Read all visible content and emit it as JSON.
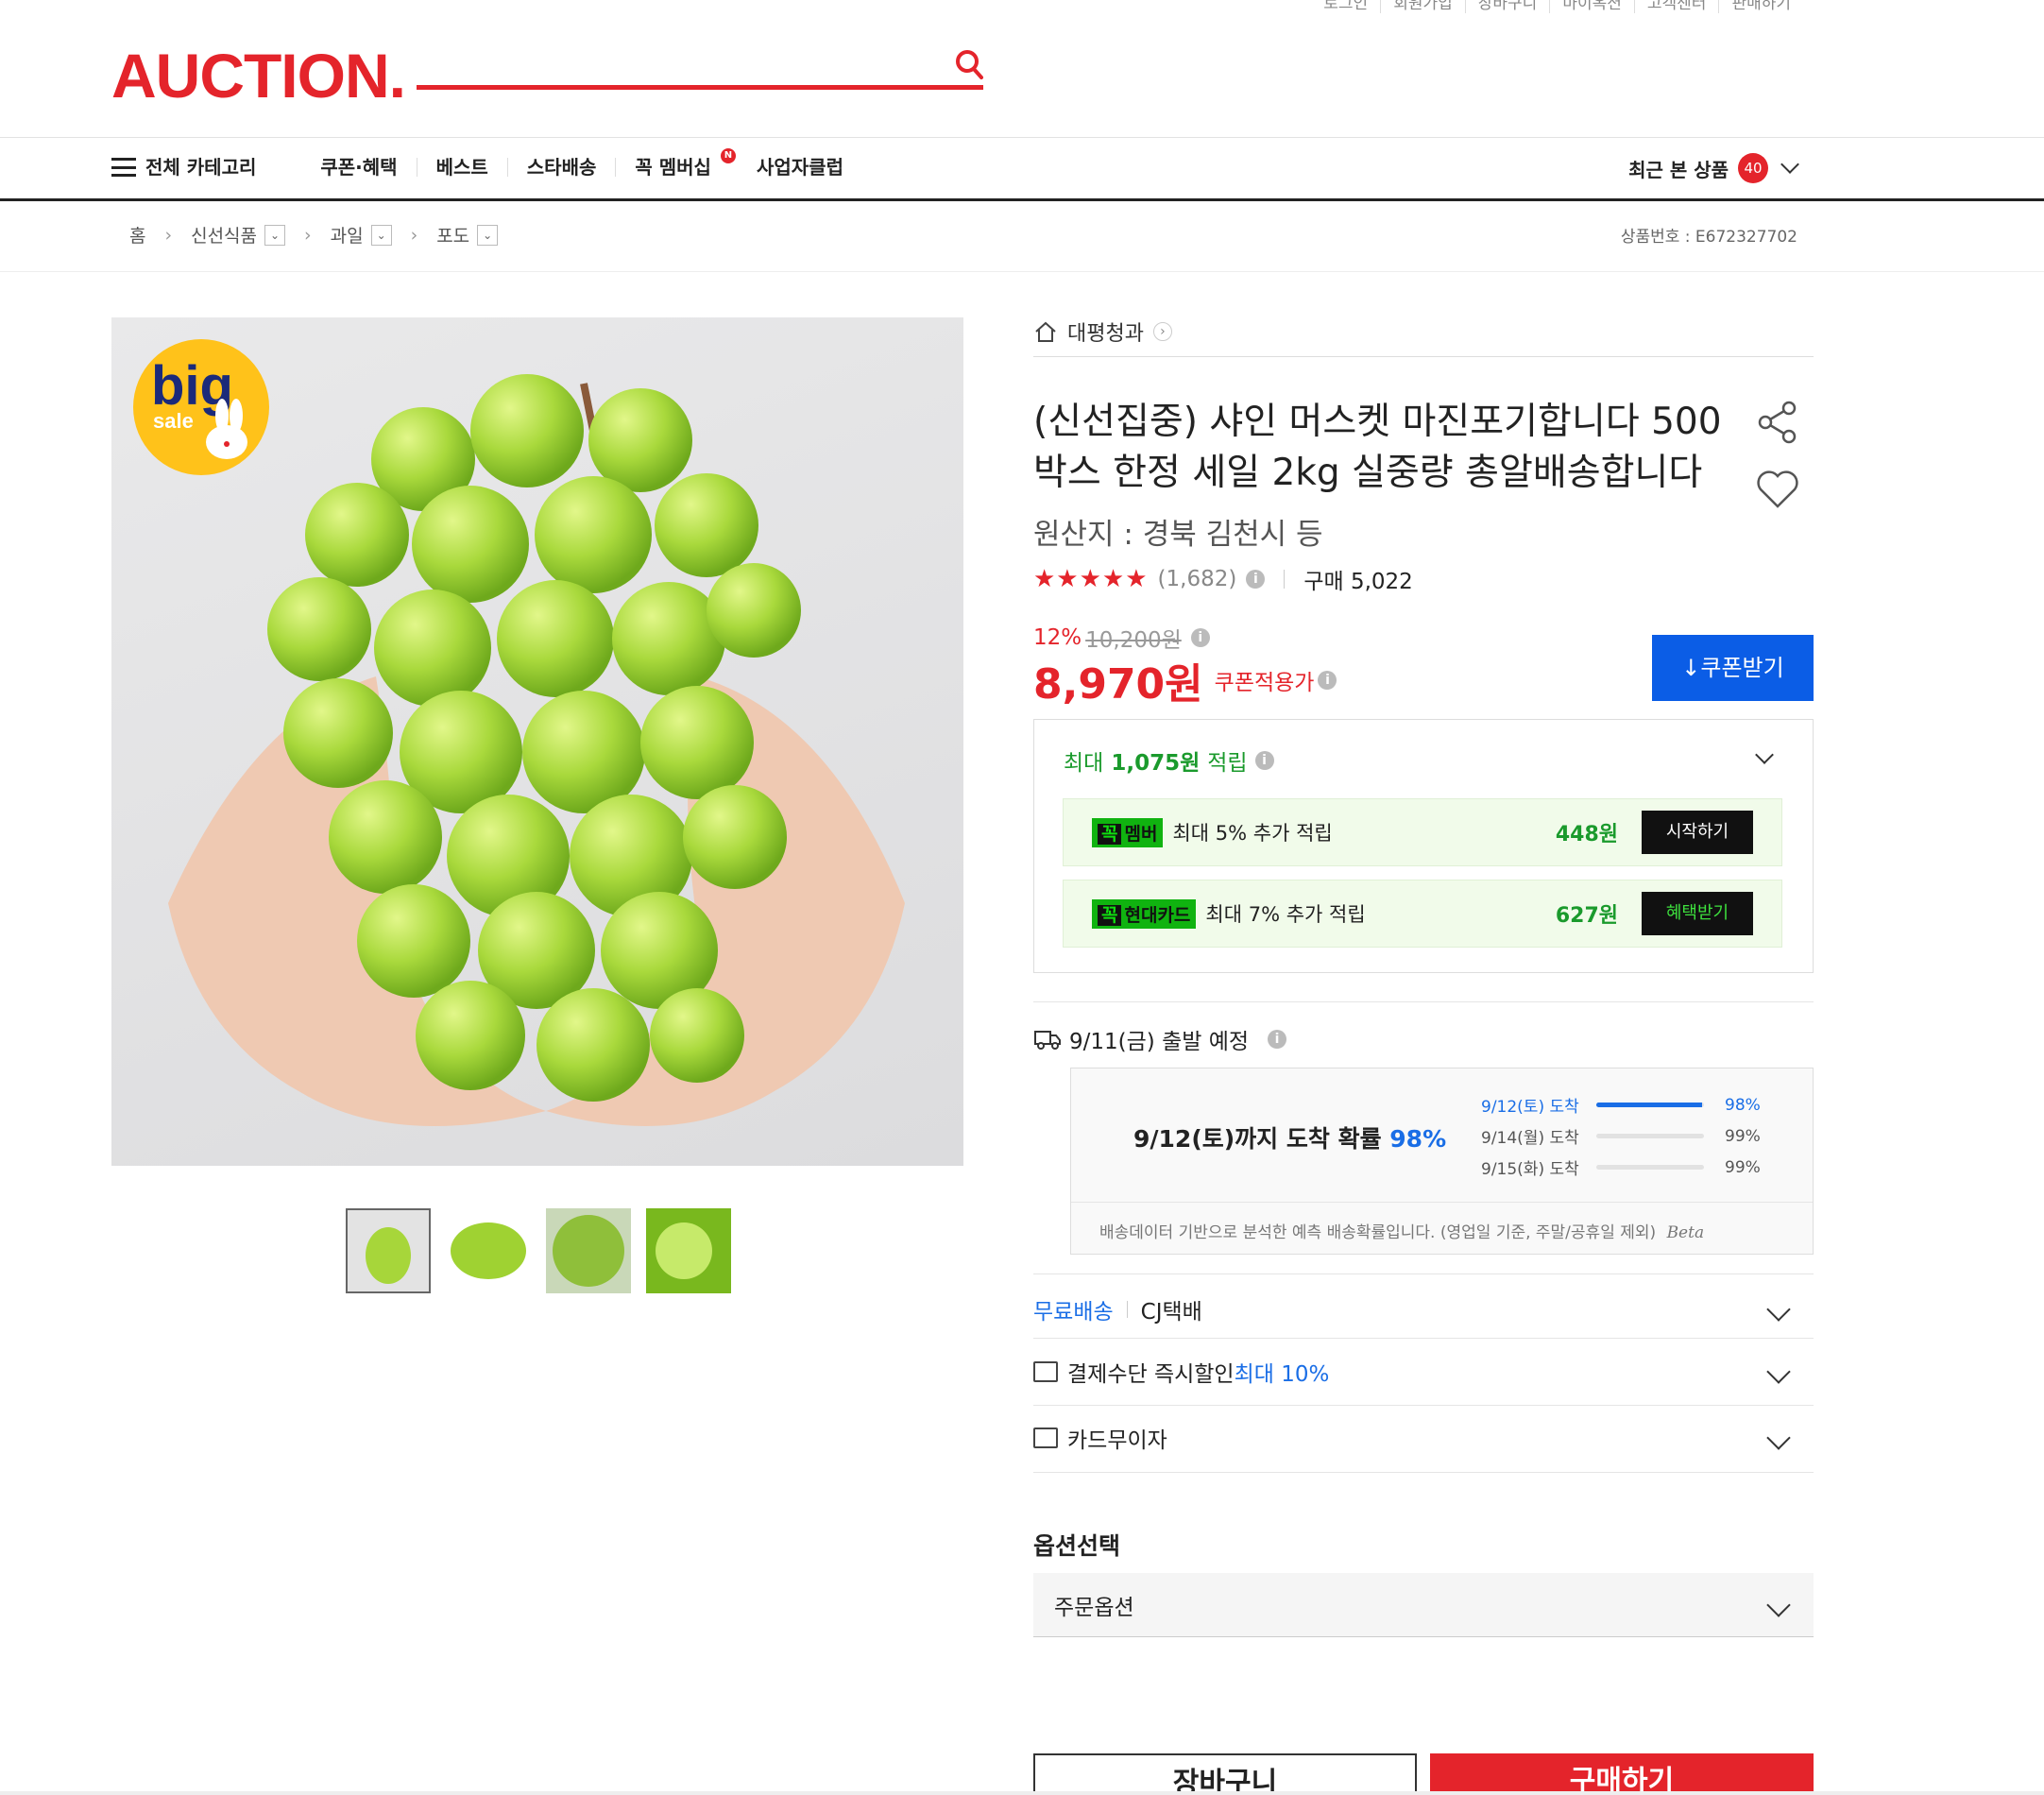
{
  "util_links": [
    "로그인",
    "회원가입",
    "장바구니",
    "마이옥션",
    "고객센터",
    "판매하기"
  ],
  "logo": "AUCTION.",
  "gnb": {
    "all_category": "전체 카테고리",
    "items": [
      "쿠폰·혜택",
      "베스트",
      "스타배송",
      "꼭 멤버십",
      "사업자클럽"
    ],
    "membership_badge": "N",
    "recent_label": "최근 본 상품",
    "recent_count": "40"
  },
  "breadcrumb": [
    "홈",
    "신선식품",
    "과일",
    "포도"
  ],
  "product_number": "상품번호 : E672327702",
  "store_name": "대평청과",
  "title": "(신선집중) 샤인 머스켓 마진포기합니다 500박스 한정 세일 2kg 실중량 총알배송합니다",
  "origin": "원산지 : 경북 김천시 등",
  "rating": {
    "stars": "★★★★★",
    "value": 4.5,
    "count": "(1,682)",
    "purchase": "구매 5,022"
  },
  "discount": {
    "rate": "12%",
    "original": "10,200원"
  },
  "price": {
    "value": "8,970원",
    "label": "쿠폰적용가"
  },
  "coupon_button": "쿠폰받기",
  "big_sale": {
    "big": "big",
    "sale": "sale"
  },
  "points": {
    "head_prefix": "최대 ",
    "head_amount": "1,075원",
    "head_suffix": " 적립",
    "rows": [
      {
        "tag_a": "꼭",
        "tag_b": "멤버",
        "text": "최대 5% 추가 적립",
        "amount": "448원",
        "button": "시작하기"
      },
      {
        "tag_a": "꼭",
        "tag_b": "현대카드",
        "text": "최대 7% 추가 적립",
        "amount": "627원",
        "button": "혜택받기"
      }
    ]
  },
  "shipping": {
    "departure": "9/11(금) 출발 예정",
    "main_prefix": "9/12(토)까지 도착 확률 ",
    "main_pct": "98%",
    "rows": [
      {
        "date": "9/12(토) 도착",
        "pct": "98%",
        "fill": 0.98
      },
      {
        "date": "9/14(월) 도착",
        "pct": "99%",
        "fill": 0
      },
      {
        "date": "9/15(화) 도착",
        "pct": "99%",
        "fill": 0
      }
    ],
    "note": "배송데이터 기반으로 분석한 예측 배송확률입니다. (영업일 기준, 주말/공휴일 제외)",
    "beta": "Beta"
  },
  "accordion": {
    "free_ship": "무료배송",
    "courier": "CJ택배",
    "pay_discount": "결제수단 즉시할인 ",
    "pay_discount_highlight": "최대 10%",
    "card_installment": "카드무이자"
  },
  "option": {
    "label": "옵션선택",
    "placeholder": "주문옵션"
  },
  "actions": {
    "cart": "장바구니",
    "buy": "구매하기"
  },
  "colors": {
    "brand_red": "#e4242b",
    "blue": "#0b5de6",
    "green": "#1a9a2c"
  }
}
